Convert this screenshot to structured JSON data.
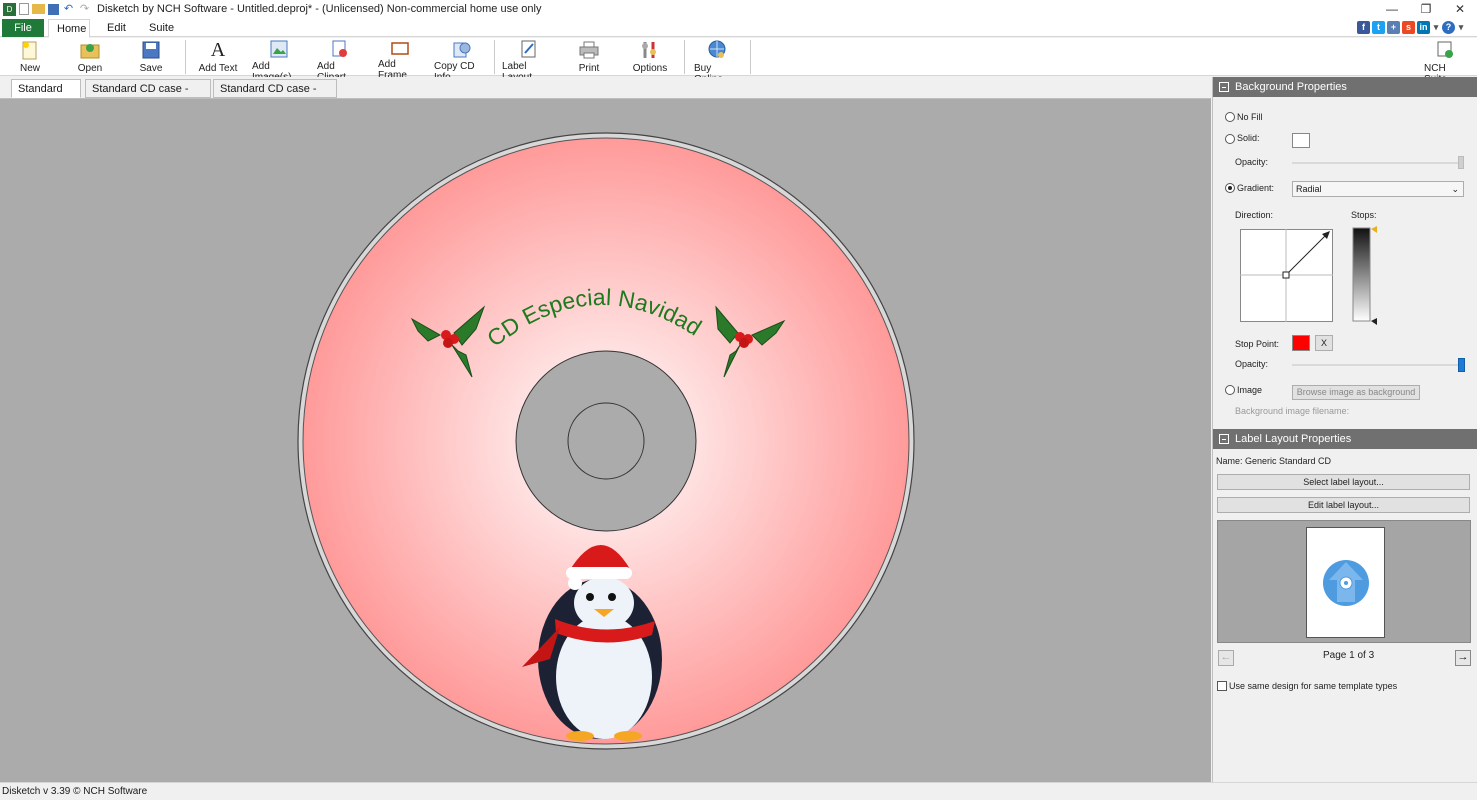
{
  "window": {
    "title": "Disketch by NCH Software - Untitled.deproj* - (Unlicensed) Non-commercial home use only"
  },
  "ribbon": {
    "tabs": [
      "File",
      "Home",
      "Edit",
      "Suite"
    ]
  },
  "toolbar": {
    "buttons": [
      "New",
      "Open",
      "Save",
      "Add Text",
      "Add Image(s)",
      "Add Clipart",
      "Add Frame",
      "Copy CD Info",
      "Label Layout",
      "Print",
      "Options",
      "Buy Online"
    ],
    "nch_suite": "NCH Suite"
  },
  "doc_tabs": [
    "Standard disc",
    "Standard CD case - Front",
    "Standard CD case - Back"
  ],
  "disc": {
    "curved_text": "CD Especial Navidad"
  },
  "background_properties": {
    "header": "Background Properties",
    "no_fill": "No Fill",
    "solid": "Solid:",
    "opacity": "Opacity:",
    "gradient": "Gradient:",
    "gradient_type": "Radial",
    "direction": "Direction:",
    "stops": "Stops:",
    "stop_point": "Stop Point:",
    "stop_point_color": "#ff0000",
    "stop_remove": "X",
    "opacity2": "Opacity:",
    "image": "Image",
    "browse": "Browse image as background",
    "bg_filename": "Background image filename:",
    "selected_option": "Gradient"
  },
  "label_layout": {
    "header": "Label Layout Properties",
    "name": "Name:  Generic Standard CD",
    "select_btn": "Select label layout...",
    "edit_btn": "Edit label layout...",
    "page": "Page 1 of 3",
    "same_design": "Use same design for same template types"
  },
  "status": {
    "text": "Disketch v 3.39 © NCH Software"
  },
  "colors": {
    "file_tab": "#1f7a3a",
    "canvas": "#ababab",
    "panel_header": "#707070",
    "disc_center": "#ffffff",
    "disc_edge": "#ff9a9a"
  }
}
